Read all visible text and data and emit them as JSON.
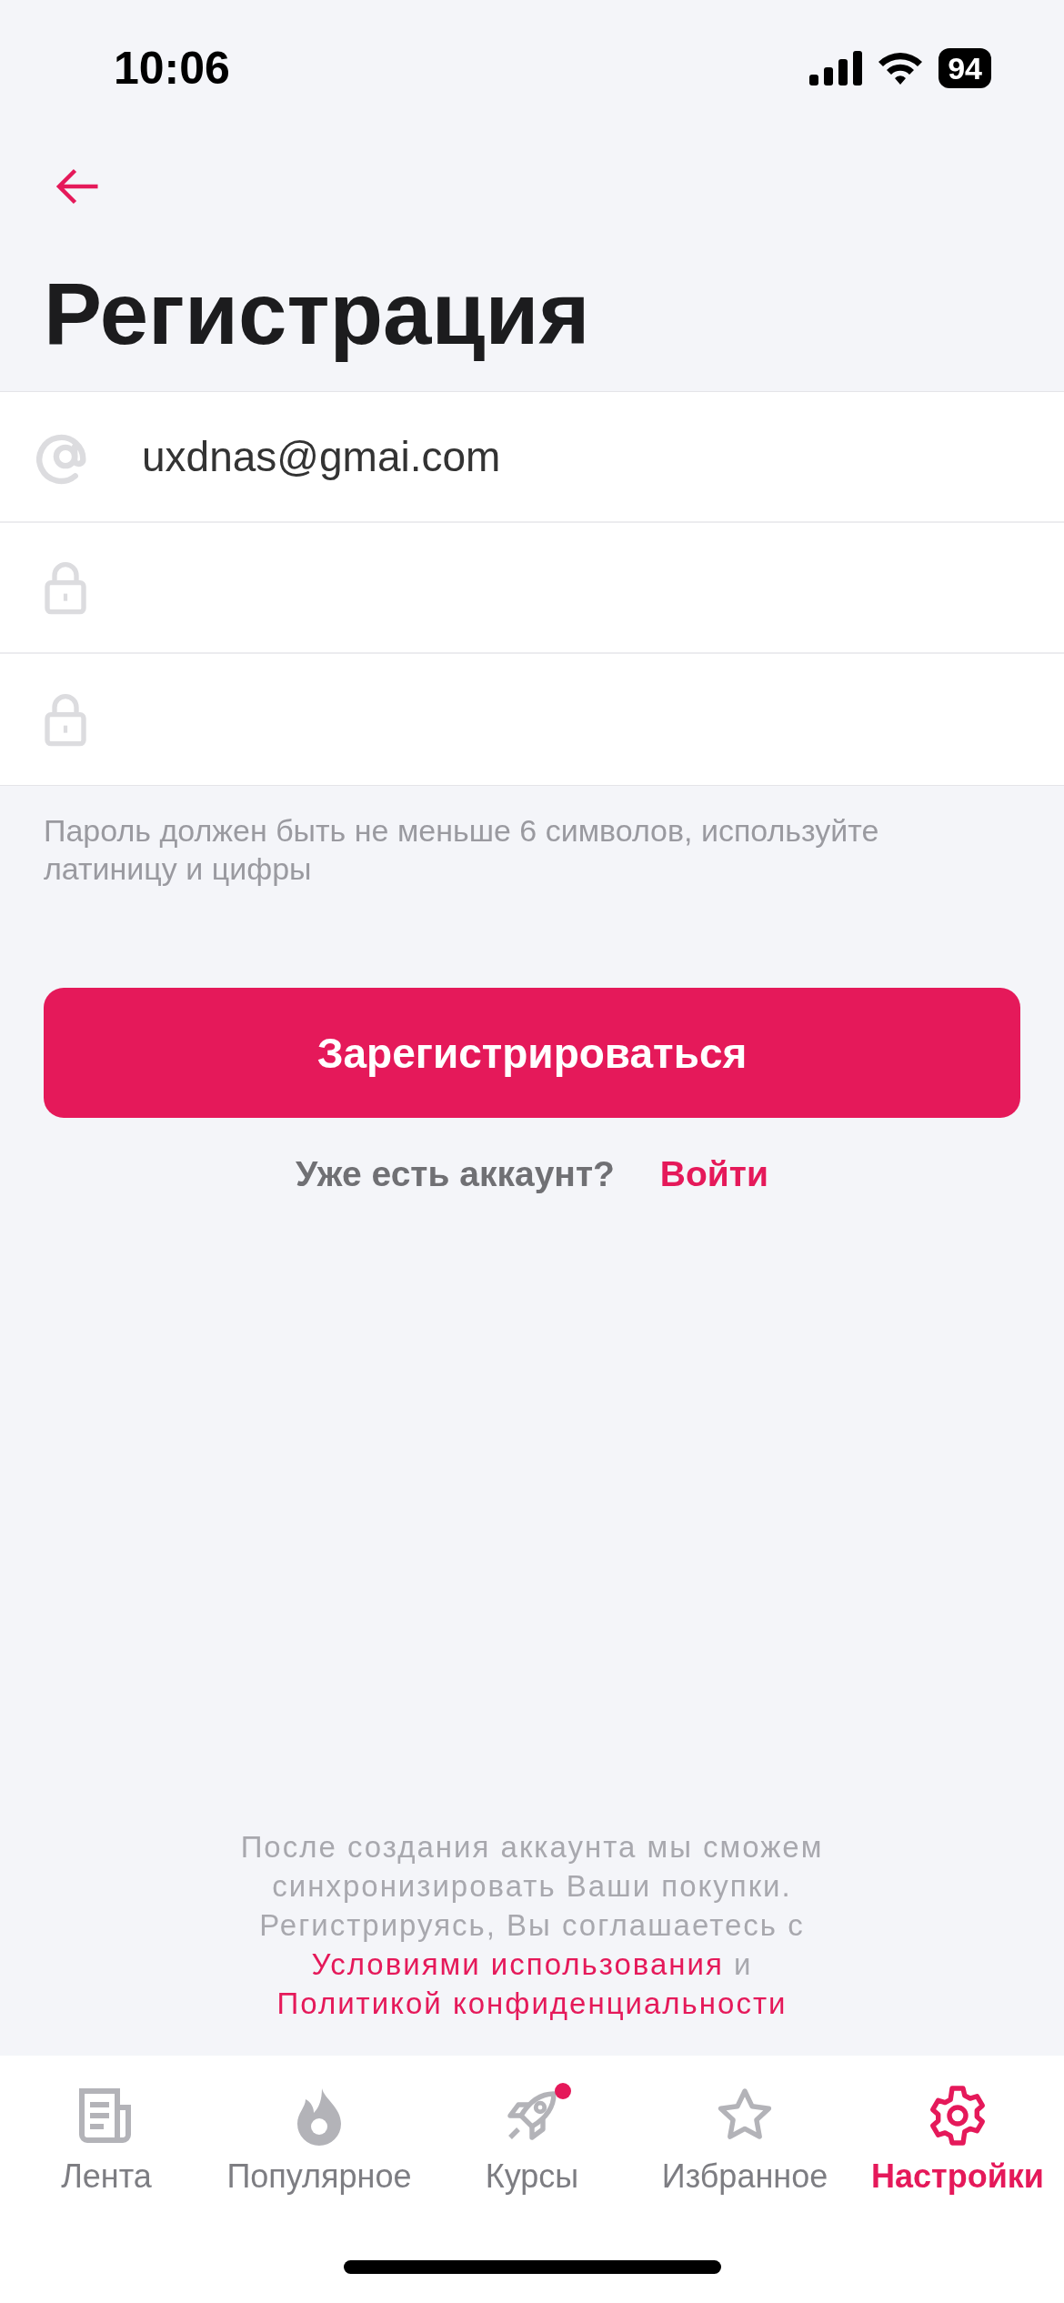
{
  "status_bar": {
    "time": "10:06",
    "battery": "94"
  },
  "title": "Регистрация",
  "fields": [
    {
      "kind": "email",
      "value": "uxdnas@gmai.com"
    },
    {
      "kind": "password"
    },
    {
      "kind": "password"
    }
  ],
  "hint": "Пароль должен быть не меньше 6 символов, используйте латиницу и цифры",
  "register_button": "Зарегистрироваться",
  "login_prompt": {
    "text": "Уже есть аккаунт?",
    "link": "Войти"
  },
  "footer": {
    "text": "После создания аккаунта мы сможем синхронизировать Ваши покупки. Регистрируясь, Вы соглашаетесь с",
    "terms_link": "Условиями использования",
    "joiner": "и",
    "privacy_link": "Политикой конфиденциальности"
  },
  "tabs": [
    {
      "label": "Лента",
      "selected": false,
      "dot": false
    },
    {
      "label": "Популярное",
      "selected": false,
      "dot": false
    },
    {
      "label": "Курсы",
      "selected": false,
      "dot": true
    },
    {
      "label": "Избранное",
      "selected": false,
      "dot": false
    },
    {
      "label": "Настройки",
      "selected": true,
      "dot": false
    }
  ]
}
